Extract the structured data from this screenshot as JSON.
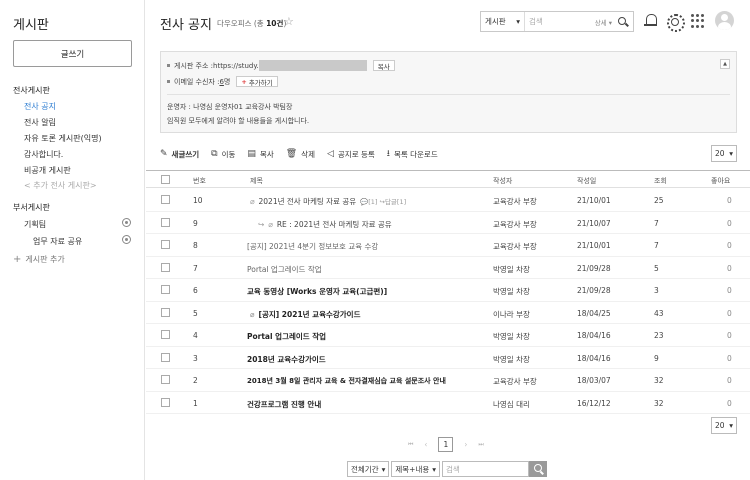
{
  "sidebar": {
    "title": "게시판",
    "write_label": "글쓰기",
    "section1": "전사게시판",
    "items1": [
      "전사 공지",
      "전사 알림",
      "자유 토론 게시판(익명)",
      "감사합니다.",
      "비공개 게시판",
      "< 추가 전사 게시판>"
    ],
    "section2": "부서게시판",
    "items2": [
      "기획팀",
      "업무 자료 공유"
    ],
    "add_label": "게시판 추가"
  },
  "header": {
    "title": "전사 공지",
    "sub_prefix": "다우오피스 (총 ",
    "sub_count": "10건",
    "sub_suffix": ")",
    "search_select": "게시판",
    "search_placeholder": "검색",
    "search_detail": "상세 ▾"
  },
  "info": {
    "address_label": "게시판 주소 :https://study.",
    "copy_label": "복사",
    "email_label": "이메일 수신자 : ",
    "email_count": "6",
    "email_suffix": " 명",
    "add_label": "추가하기",
    "operator": "운영자 : 나영심 운영자01 교육강사 박팀장",
    "description": "임직원 모두에게 알려야 할 내용들을 게시합니다."
  },
  "toolbar": {
    "new_post": "새글쓰기",
    "move": "이동",
    "copy": "복사",
    "delete": "삭제",
    "notice": "공지로 등록",
    "download": "목록 다운로드",
    "page_size": "20"
  },
  "table": {
    "headers": [
      "번호",
      "제목",
      "작성자",
      "작성일",
      "조회",
      "좋아요"
    ],
    "rows": [
      {
        "num": "10",
        "title": "2021년 전사 마케팅 자료 공유",
        "meta": "💬[1] ↪답글[1]",
        "author": "교육강사 부장",
        "date": "21/10/01",
        "views": "25",
        "likes": "0"
      },
      {
        "num": "9",
        "title": "RE : 2021년 전사 마케팅 자료 공유",
        "meta": "",
        "author": "교육강사 부장",
        "date": "21/10/07",
        "views": "7",
        "likes": "0"
      },
      {
        "num": "8",
        "title": "[공지] 2021년 4분기 정보보호 교육 수강",
        "meta": "",
        "author": "교육강사 부장",
        "date": "21/10/01",
        "views": "7",
        "likes": "0"
      },
      {
        "num": "7",
        "title": "Portal 업그레이드 작업",
        "meta": "",
        "author": "박영일 차장",
        "date": "21/09/28",
        "views": "5",
        "likes": "0"
      },
      {
        "num": "6",
        "title": "교육 동영상 [Works 운영자 교육(고급편)]",
        "meta": "",
        "author": "박영일 차장",
        "date": "21/09/28",
        "views": "3",
        "likes": "0"
      },
      {
        "num": "5",
        "title": "[공지] 2021년 교육수강가이드",
        "meta": "",
        "author": "이나라 부장",
        "date": "18/04/25",
        "views": "43",
        "likes": "0"
      },
      {
        "num": "4",
        "title": "Portal 업그레이드 작업",
        "meta": "",
        "author": "박영일 차장",
        "date": "18/04/16",
        "views": "23",
        "likes": "0"
      },
      {
        "num": "3",
        "title": "2018년 교육수강가이드",
        "meta": "",
        "author": "박영일 차장",
        "date": "18/04/16",
        "views": "9",
        "likes": "0"
      },
      {
        "num": "2",
        "title": "2018년 3월 8일 관리자 교육 & 전자결재심습 교육 설문조사 안내",
        "meta": "",
        "author": "교육강사 부장",
        "date": "18/03/07",
        "views": "32",
        "likes": "0"
      },
      {
        "num": "1",
        "title": "건강프로그램 진행 안내",
        "meta": "",
        "author": "나영심 대리",
        "date": "16/12/12",
        "views": "32",
        "likes": "0"
      }
    ]
  },
  "pager": {
    "first": "⏮",
    "prev": "‹",
    "current": "1",
    "next": "›",
    "last": "⏭",
    "page_size": "20"
  },
  "bottom_search": {
    "period": "전체기간",
    "field": "제목+내용",
    "placeholder": "검색"
  }
}
